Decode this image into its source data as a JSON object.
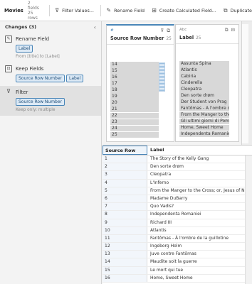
{
  "toolbar": {
    "title": "Movies",
    "meta": "2 fields  25 rows",
    "filter_values": "Filter Values...",
    "rename_field": "Rename Field",
    "create_calc": "Create Calculated Field...",
    "duplicate": "Duplicate"
  },
  "changes": {
    "header": "Changes (3)",
    "items": [
      {
        "title": "Rename Field",
        "chips": [
          "Label"
        ],
        "sub": "From [title] to [Label]"
      },
      {
        "title": "Keep Fields",
        "chips": [
          "Source Row Number",
          "Label"
        ]
      },
      {
        "title": "Filter",
        "chips": [
          "Source Row Number"
        ],
        "sub": "Keep only: multiple"
      }
    ]
  },
  "profile": {
    "card1": {
      "type": "#",
      "name": "Source Row Number",
      "count": "25",
      "values": [
        "14",
        "15",
        "16",
        "17",
        "18",
        "19",
        "20",
        "21",
        "22",
        "23",
        "24",
        "25"
      ]
    },
    "card2": {
      "type": "Abc",
      "name": "Label",
      "count": "25",
      "values": [
        "Assunta Spina",
        "Atlantis",
        "Cabiria",
        "Cinderella",
        "Cleopatra",
        "Den sorte drøm",
        "Der Student von Prag",
        "Fantômas - À l'ombre de la",
        "From the Manger to the C",
        "Gli ultimi giorni di Pompe",
        "Home, Sweet Home",
        "Independenta Romaniei"
      ]
    }
  },
  "grid": {
    "headers": [
      "Source Row Number",
      "Label"
    ],
    "rows": [
      [
        "1",
        "The Story of the Kelly Gang"
      ],
      [
        "2",
        "Den sorte drøm"
      ],
      [
        "3",
        "Cleopatra"
      ],
      [
        "4",
        "L'Inferno"
      ],
      [
        "5",
        "From the Manger to the Cross; or, Jesus of Nazareth"
      ],
      [
        "6",
        "Madame DuBarry"
      ],
      [
        "7",
        "Quo Vadis?"
      ],
      [
        "8",
        "Independenta Romaniei"
      ],
      [
        "9",
        "Richard III"
      ],
      [
        "10",
        "Atlantis"
      ],
      [
        "11",
        "Fantômas - À l'ombre de la guillotine"
      ],
      [
        "12",
        "Ingeborg Holm"
      ],
      [
        "13",
        "Juve contre Fantômas"
      ],
      [
        "14",
        "Maudite soit la guerre"
      ],
      [
        "15",
        "Le mort qui tue"
      ],
      [
        "16",
        "Home, Sweet Home"
      ]
    ]
  }
}
